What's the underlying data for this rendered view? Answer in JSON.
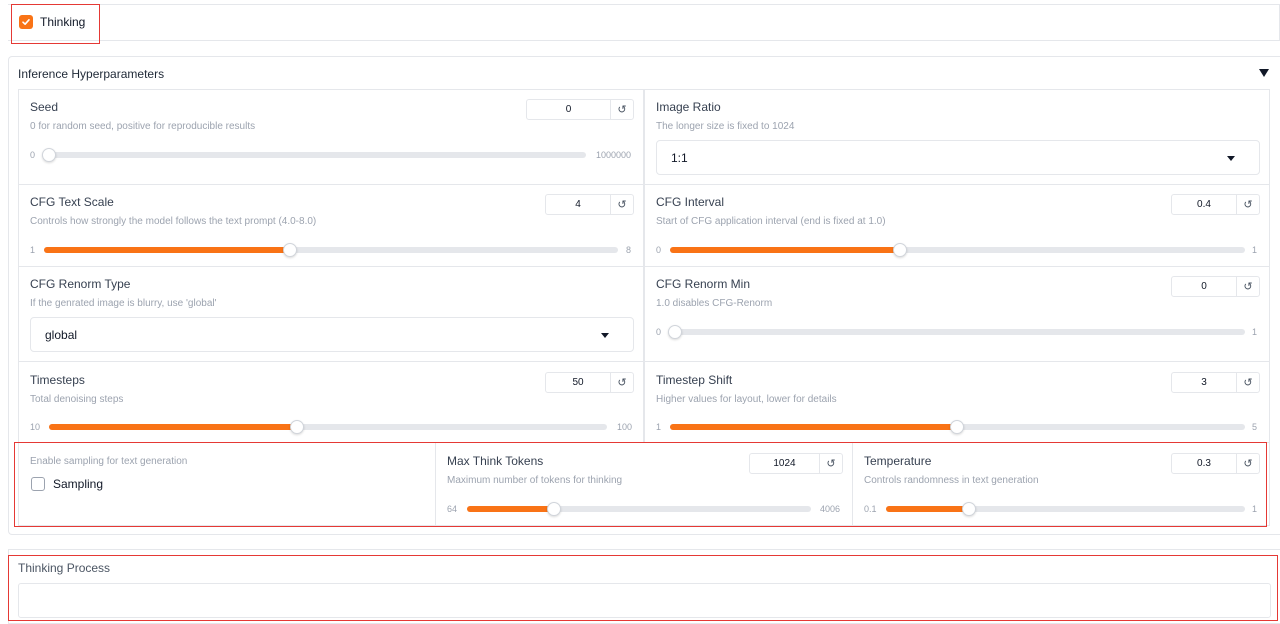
{
  "thinking": {
    "label": "Thinking",
    "checked": true
  },
  "accordion": {
    "title": "Inference Hyperparameters",
    "toggle_icon": "triangle-down-icon"
  },
  "params": {
    "seed": {
      "label": "Seed",
      "info": "0 for random seed, positive for reproducible results",
      "value": "0",
      "min": "0",
      "max": "1000000",
      "fraction": 0.0
    },
    "image_ratio": {
      "label": "Image Ratio",
      "info": "The longer size is fixed to 1024",
      "selected": "1:1"
    },
    "cfg_text_scale": {
      "label": "CFG Text Scale",
      "info": "Controls how strongly the model follows the text prompt (4.0-8.0)",
      "value": "4",
      "min": "1",
      "max": "8",
      "fraction": 0.4286
    },
    "cfg_interval": {
      "label": "CFG Interval",
      "info": "Start of CFG application interval (end is fixed at 1.0)",
      "value": "0.4",
      "min": "0",
      "max": "1",
      "fraction": 0.4
    },
    "cfg_renorm_type": {
      "label": "CFG Renorm Type",
      "info": "If the genrated image is blurry, use 'global'",
      "selected": "global"
    },
    "cfg_renorm_min": {
      "label": "CFG Renorm Min",
      "info": "1.0 disables CFG-Renorm",
      "value": "0",
      "min": "0",
      "max": "1",
      "fraction": 0.0
    },
    "timesteps": {
      "label": "Timesteps",
      "info": "Total denoising steps",
      "value": "50",
      "min": "10",
      "max": "100",
      "fraction": 0.4444
    },
    "timestep_shift": {
      "label": "Timestep Shift",
      "info": "Higher values for layout, lower for details",
      "value": "3",
      "min": "1",
      "max": "5",
      "fraction": 0.5
    },
    "sampling": {
      "info": "Enable sampling for text generation",
      "label": "Sampling",
      "checked": false
    },
    "max_think_tokens": {
      "label": "Max Think Tokens",
      "info": "Maximum number of tokens for thinking",
      "value": "1024",
      "min": "64",
      "max": "4006",
      "fraction": 0.2435
    },
    "temperature": {
      "label": "Temperature",
      "info": "Controls randomness in text generation",
      "value": "0.3",
      "min": "0.1",
      "max": "1",
      "fraction": 0.2222
    }
  },
  "thinking_process": {
    "label": "Thinking Process",
    "value": ""
  },
  "icons": {
    "reset": "reset-icon",
    "dropdown": "chevron-down-icon",
    "check": "check-icon"
  },
  "colors": {
    "accent": "#f97316",
    "highlight": "#e53935",
    "border": "#e5e7eb"
  }
}
